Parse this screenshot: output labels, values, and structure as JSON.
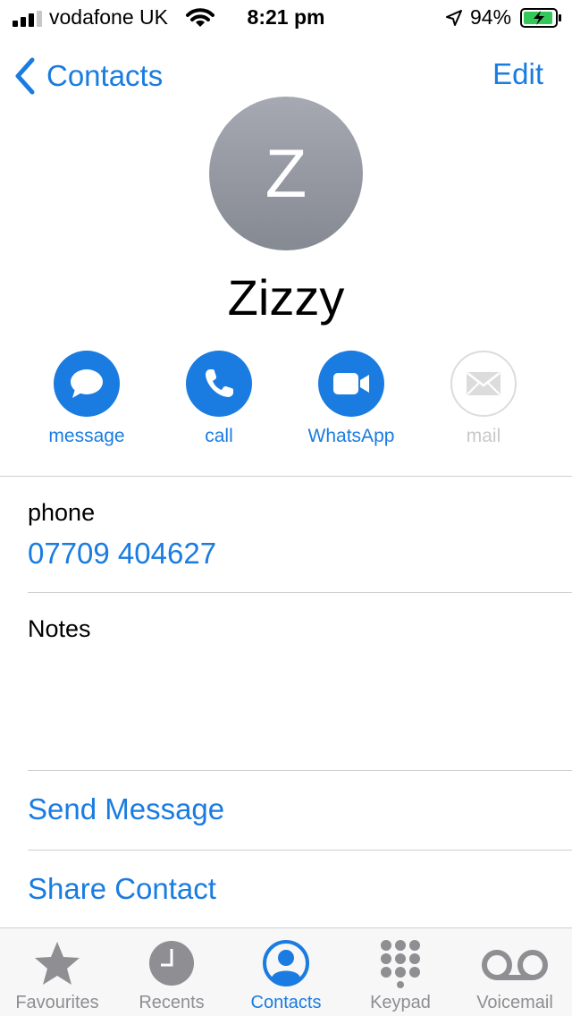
{
  "status_bar": {
    "carrier": "vodafone UK",
    "time": "8:21 pm",
    "battery_percent": "94%",
    "battery_level": 0.94
  },
  "nav": {
    "back_label": "Contacts",
    "edit_label": "Edit"
  },
  "contact": {
    "initial": "Z",
    "name": "Zizzy"
  },
  "actions": [
    {
      "label": "message",
      "icon": "message-bubble-icon",
      "enabled": true
    },
    {
      "label": "call",
      "icon": "phone-icon",
      "enabled": true
    },
    {
      "label": "WhatsApp",
      "icon": "video-camera-icon",
      "enabled": true
    },
    {
      "label": "mail",
      "icon": "envelope-icon",
      "enabled": false
    }
  ],
  "phone": {
    "label": "phone",
    "value": "07709 404627"
  },
  "notes": {
    "label": "Notes"
  },
  "links": {
    "send_message": "Send Message",
    "share_contact": "Share Contact"
  },
  "tabs": [
    {
      "label": "Favourites",
      "icon": "star-icon",
      "active": false
    },
    {
      "label": "Recents",
      "icon": "clock-icon",
      "active": false
    },
    {
      "label": "Contacts",
      "icon": "person-circle-icon",
      "active": true
    },
    {
      "label": "Keypad",
      "icon": "keypad-icon",
      "active": false
    },
    {
      "label": "Voicemail",
      "icon": "voicemail-icon",
      "active": false
    }
  ],
  "colors": {
    "accent": "#1a7ce0",
    "inactive_tab": "#8e8e93",
    "battery_fill": "#34c759",
    "avatar_top": "#a6a9b2",
    "avatar_bottom": "#858992"
  }
}
